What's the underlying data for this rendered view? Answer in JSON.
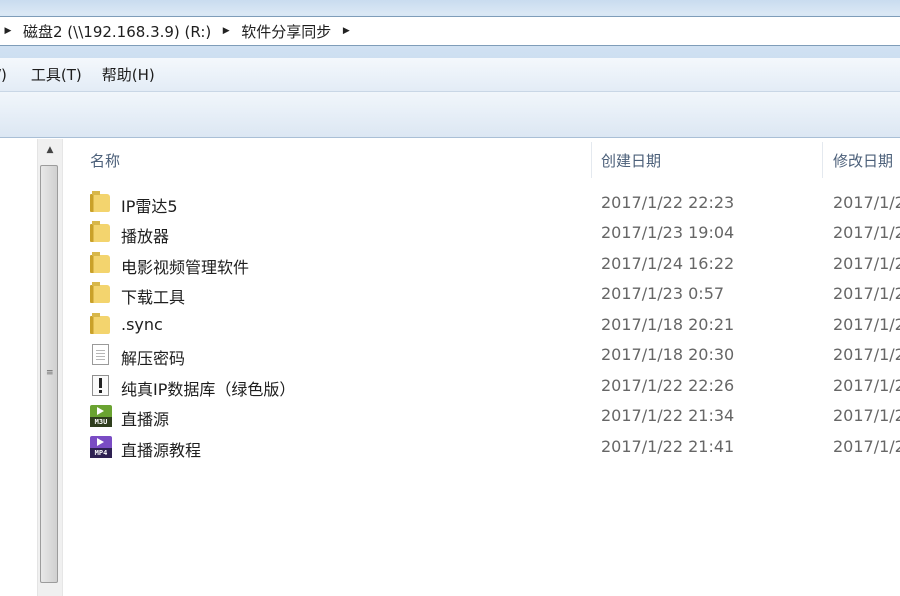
{
  "address": {
    "crumbs": [
      "磁盘2 (\\\\192.168.3.9) (R:)",
      "软件分享同步"
    ]
  },
  "menubar": {
    "cut_item": "/)",
    "tools": "工具(T)",
    "help": "帮助(H)"
  },
  "columns": {
    "name": "名称",
    "created": "创建日期",
    "modified": "修改日期"
  },
  "files": [
    {
      "name": "IP雷达5",
      "created": "2017/1/22 22:23",
      "modified": "2017/1/2",
      "icon": "folder-icon"
    },
    {
      "name": "播放器",
      "created": "2017/1/23 19:04",
      "modified": "2017/1/2",
      "icon": "folder-icon"
    },
    {
      "name": "电影视频管理软件",
      "created": "2017/1/24 16:22",
      "modified": "2017/1/2",
      "icon": "folder-icon"
    },
    {
      "name": "下载工具",
      "created": "2017/1/23 0:57",
      "modified": "2017/1/2",
      "icon": "folder-icon"
    },
    {
      "name": ".sync",
      "created": "2017/1/18 20:21",
      "modified": "2017/1/2",
      "icon": "folder-icon"
    },
    {
      "name": "解压密码",
      "created": "2017/1/18 20:30",
      "modified": "2017/1/2",
      "icon": "text-document-icon"
    },
    {
      "name": "纯真IP数据库（绿色版）",
      "created": "2017/1/22 22:26",
      "modified": "2017/1/2",
      "icon": "executable-icon"
    },
    {
      "name": "直播源",
      "created": "2017/1/22 21:34",
      "modified": "2017/1/2",
      "icon": "m3u-file-icon",
      "badge": "M3U"
    },
    {
      "name": "直播源教程",
      "created": "2017/1/22 21:41",
      "modified": "2017/1/2",
      "icon": "mp4-file-icon",
      "badge": "MP4"
    }
  ]
}
